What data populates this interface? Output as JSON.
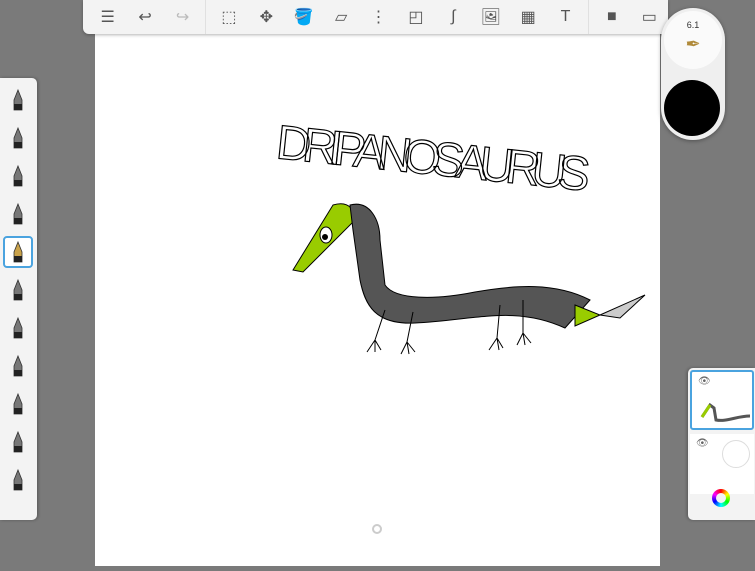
{
  "toolbar": {
    "items": [
      {
        "name": "layer-list",
        "glyph": "☰"
      },
      {
        "name": "undo",
        "glyph": "↩"
      },
      {
        "name": "redo",
        "glyph": "↪",
        "disabled": true
      },
      {
        "name": "selection",
        "glyph": "⬚"
      },
      {
        "name": "transform",
        "glyph": "✥"
      },
      {
        "name": "fill",
        "glyph": "🪣"
      },
      {
        "name": "ruler",
        "glyph": "▱"
      },
      {
        "name": "symmetry",
        "glyph": "⋮"
      },
      {
        "name": "shapes",
        "glyph": "◰"
      },
      {
        "name": "curve",
        "glyph": "∫"
      },
      {
        "name": "add-image",
        "glyph": "🖼"
      },
      {
        "name": "perspective",
        "glyph": "▦"
      },
      {
        "name": "text",
        "glyph": "T"
      },
      {
        "name": "copic",
        "glyph": "■"
      },
      {
        "name": "fullscreen",
        "glyph": "▭"
      }
    ]
  },
  "brushes": [
    "brush-settings",
    "airbrush",
    "pencil",
    "marker",
    "pen",
    "chisel",
    "paintbrush",
    "ink",
    "soft-eraser",
    "smudge",
    "eraser"
  ],
  "selected_brush": "pen",
  "brush_puck": {
    "size": "6.1",
    "color": "#000000"
  },
  "drawing": {
    "title": "DRIPANOSAURUS",
    "body_color": "#555555",
    "head_color": "#99cc00"
  },
  "layers": [
    {
      "visible": true,
      "selected": true
    },
    {
      "visible": true,
      "selected": false
    }
  ]
}
